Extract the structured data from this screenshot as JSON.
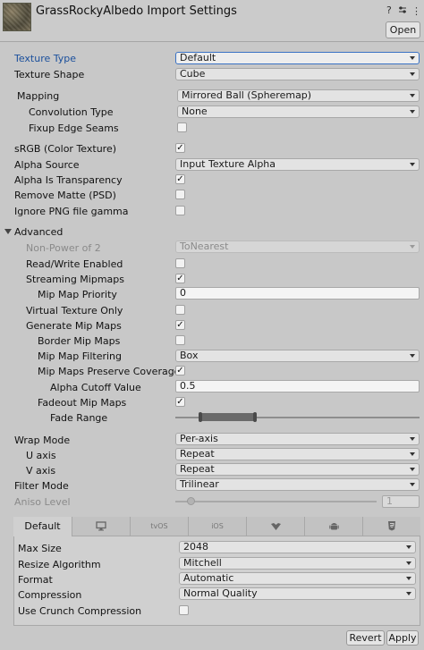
{
  "header": {
    "title": "GrassRockyAlbedo Import Settings",
    "help_icon": "?",
    "settings_icon": "sliders",
    "menu_icon": "⋮",
    "open_label": "Open"
  },
  "texture_type": {
    "label": "Texture Type",
    "value": "Default"
  },
  "texture_shape": {
    "label": "Texture Shape",
    "value": "Cube"
  },
  "mapping": {
    "label": "Mapping",
    "value": "Mirrored Ball (Spheremap)"
  },
  "convolution_type": {
    "label": "Convolution Type",
    "value": "None"
  },
  "fixup_edge_seams": {
    "label": "Fixup Edge Seams",
    "checked": false
  },
  "srgb": {
    "label": "sRGB (Color Texture)",
    "checked": true
  },
  "alpha_source": {
    "label": "Alpha Source",
    "value": "Input Texture Alpha"
  },
  "alpha_is_transparency": {
    "label": "Alpha Is Transparency",
    "checked": true
  },
  "remove_matte": {
    "label": "Remove Matte (PSD)",
    "checked": false
  },
  "ignore_png_gamma": {
    "label": "Ignore PNG file gamma",
    "checked": false
  },
  "advanced": {
    "label": "Advanced",
    "non_power_of_2": {
      "label": "Non-Power of 2",
      "value": "ToNearest"
    },
    "read_write": {
      "label": "Read/Write Enabled",
      "checked": false
    },
    "streaming_mipmaps": {
      "label": "Streaming Mipmaps",
      "checked": true
    },
    "mip_map_priority": {
      "label": "Mip Map Priority",
      "value": "0"
    },
    "virtual_texture_only": {
      "label": "Virtual Texture Only",
      "checked": false
    },
    "generate_mip_maps": {
      "label": "Generate Mip Maps",
      "checked": true
    },
    "border_mip_maps": {
      "label": "Border Mip Maps",
      "checked": false
    },
    "mip_map_filtering": {
      "label": "Mip Map Filtering",
      "value": "Box"
    },
    "preserve_coverage": {
      "label": "Mip Maps Preserve Coverage",
      "checked": true
    },
    "alpha_cutoff": {
      "label": "Alpha Cutoff Value",
      "value": "0.5"
    },
    "fadeout_mip_maps": {
      "label": "Fadeout Mip Maps",
      "checked": true
    },
    "fade_range": {
      "label": "Fade Range"
    }
  },
  "wrap_mode": {
    "label": "Wrap Mode",
    "value": "Per-axis"
  },
  "u_axis": {
    "label": "U axis",
    "value": "Repeat"
  },
  "v_axis": {
    "label": "V axis",
    "value": "Repeat"
  },
  "filter_mode": {
    "label": "Filter Mode",
    "value": "Trilinear"
  },
  "aniso_level": {
    "label": "Aniso Level",
    "value": "1"
  },
  "platform_tabs": [
    {
      "label": "Default",
      "icon": ""
    },
    {
      "label": "",
      "icon": "monitor-icon"
    },
    {
      "label": "tvOS",
      "icon": ""
    },
    {
      "label": "iOS",
      "icon": ""
    },
    {
      "label": "",
      "icon": "webgl-icon"
    },
    {
      "label": "",
      "icon": "android-icon"
    },
    {
      "label": "",
      "icon": "html5-icon"
    }
  ],
  "platform": {
    "max_size": {
      "label": "Max Size",
      "value": "2048"
    },
    "resize_algorithm": {
      "label": "Resize Algorithm",
      "value": "Mitchell"
    },
    "format": {
      "label": "Format",
      "value": "Automatic"
    },
    "compression": {
      "label": "Compression",
      "value": "Normal Quality"
    },
    "crunch": {
      "label": "Use Crunch Compression",
      "checked": false
    }
  },
  "footer": {
    "revert_label": "Revert",
    "apply_label": "Apply"
  },
  "colors": {
    "accent": "#3a72c4",
    "label_blue": "#1a4f9c",
    "background": "#c8c8c8"
  }
}
